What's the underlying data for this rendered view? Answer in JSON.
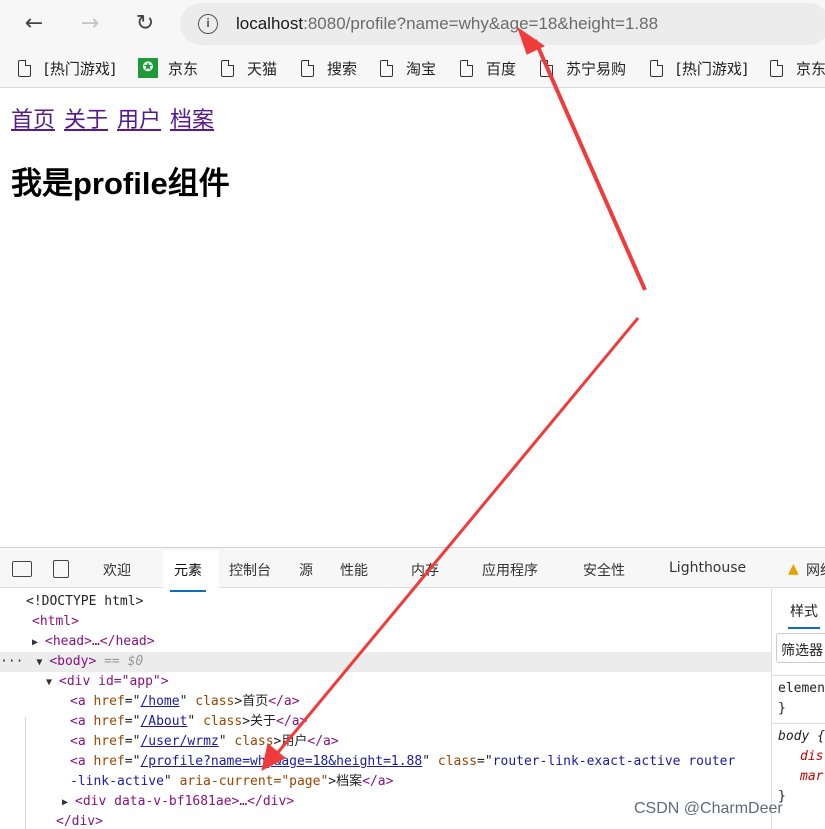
{
  "browser": {
    "url_host": "localhost",
    "url_rest": ":8080/profile?name=why&age=18&height=1.88"
  },
  "bookmarks": [
    {
      "label": "[热门游戏]",
      "icon": "page-icon"
    },
    {
      "label": "京东",
      "icon": "jd-icon"
    },
    {
      "label": "天猫",
      "icon": "page-icon"
    },
    {
      "label": "搜索",
      "icon": "page-icon"
    },
    {
      "label": "淘宝",
      "icon": "page-icon"
    },
    {
      "label": "百度",
      "icon": "page-icon"
    },
    {
      "label": "苏宁易购",
      "icon": "page-icon"
    },
    {
      "label": "[热门游戏]",
      "icon": "page-icon"
    },
    {
      "label": "京东",
      "icon": "page-icon"
    }
  ],
  "page": {
    "nav": [
      "首页",
      "关于",
      "用户",
      "档案"
    ],
    "title": "我是profile组件"
  },
  "devtools": {
    "tabs": [
      "欢迎",
      "元素",
      "控制台",
      "源",
      "性能",
      "内存",
      "应用程序",
      "安全性",
      "Lighthouse",
      "网络"
    ],
    "styles_tab": "样式",
    "filter": "筛选器",
    "styles_lines": [
      "element",
      "}",
      "body {",
      "dis",
      "mar",
      "}"
    ],
    "dom": {
      "doctype": "<!DOCTYPE html>",
      "html": "<html>",
      "head": "<head>…</head>",
      "body_tag": "<body>",
      "body_note": "== $0",
      "app_div": "<div id=\"app\">",
      "links": [
        {
          "href": "/home",
          "text": "首页"
        },
        {
          "href": "/About",
          "text": "关于"
        },
        {
          "href": "/user/wrmz",
          "text": "用户"
        },
        {
          "href": "/profile?name=why&age=18&height=1.88",
          "text": "档案"
        }
      ],
      "active_class": "router-link-exact-active router",
      "active_class_cont": "-link-active",
      "aria": "aria-current=\"page\"",
      "child_div": "<div data-v-bf1681ae>…</div>",
      "close_div": "</div>"
    }
  },
  "watermark": "CSDN @CharmDeer",
  "colors": {
    "arrow": "#ef3b3b",
    "link_visited": "#551a8b",
    "tab_accent": "#0f6cbd"
  }
}
